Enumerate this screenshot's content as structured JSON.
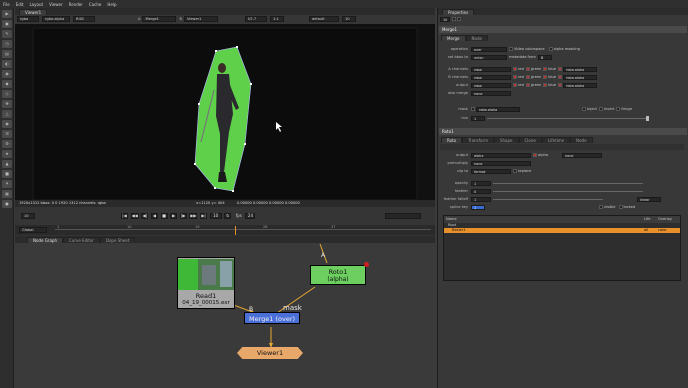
{
  "menu": [
    "File",
    "Edit",
    "Layout",
    "Viewer",
    "Render",
    "Cache",
    "Help"
  ],
  "toolbar_icons": [
    "pointer-icon",
    "image-icon",
    "draw-icon",
    "time-icon",
    "channel-icon",
    "color-icon",
    "filter-icon",
    "keyer-icon",
    "merge-icon",
    "transform-icon",
    "3d-icon",
    "views-icon",
    "metadata-icon",
    "toolsets-icon",
    "other-icon",
    "furnace-icon",
    "ofx-icon",
    "particles-icon",
    "deep-icon",
    "cara-icon"
  ],
  "viewer": {
    "tab_label": "Viewer1",
    "channels": "rgba",
    "channel_sub": "rgba.alpha",
    "channel_color": "RGB",
    "input_a": "Merge1",
    "input_b": "Viewer1",
    "zoom": "f/2.7",
    "frame": "10",
    "lut_default": "default",
    "lut_srgb": "sRGB",
    "proxy_label": "1:1",
    "lut_label": "gain",
    "status_text": "1920x1312 bbox: 0 0 1920 1312 channels: rgba",
    "status_coords": "x=1120 y= 404",
    "status_vals": "0.00000  0.00000  0.00000  0.00000",
    "frame_display": "10",
    "fps_label": "fps",
    "fps": "24",
    "range_mode": "Global",
    "ticks": [
      "1",
      "10",
      "19",
      "28",
      "37"
    ]
  },
  "nodegraph_tabs": [
    "Node Graph",
    "Curve Editor",
    "Dope Sheet"
  ],
  "nodes": {
    "read": {
      "label": "Read1",
      "sub": "04_19_00015.exr"
    },
    "roto": {
      "label": "Roto1",
      "sub": "(alpha)"
    },
    "merge": {
      "label": "Merge1 (over)"
    },
    "viewer": {
      "label": "Viewer1"
    },
    "mask_label": "mask",
    "a_label": "A",
    "b_label": "B"
  },
  "properties": {
    "panel_title": "Properties",
    "merge": {
      "title": "Merge1",
      "tabs": [
        "Merge",
        "Node"
      ],
      "operation_label": "operation",
      "operation": "over",
      "video_colorspace": "Video colorspace",
      "alpha_masking": "alpha masking",
      "set_bbox_label": "set bbox to",
      "set_bbox": "union",
      "metadata_from_label": "metadata from",
      "metadata_from": "B",
      "a_channels_label": "A channels",
      "a_channels": "rgba",
      "b_channels_label": "B channels",
      "b_channels": "rgba",
      "output_label": "output",
      "output": "rgba",
      "also_merge_label": "also merge",
      "also_merge": "none",
      "red": "red",
      "green": "green",
      "blue": "blue",
      "alpha": "rgba.alpha",
      "mask_label": "mask",
      "mask": "rgba.alpha",
      "inject": "inject",
      "invert": "invert",
      "fringe": "fringe",
      "mix_label": "mix",
      "mix": "1",
      "mix_ticks": [
        "0",
        "0.1",
        "0.2",
        "0.3",
        "0.4",
        "0.5",
        "0.6",
        "0.7",
        "0.8",
        "0.9",
        "1"
      ]
    },
    "roto": {
      "title": "Roto1",
      "tabs": [
        "Roto",
        "Transform",
        "Shape",
        "Clone",
        "Lifetime",
        "Node"
      ],
      "output_label": "output",
      "output": "alpha",
      "output_check": "alpha",
      "output_extra": "none",
      "premultiply_label": "premultiply",
      "premultiply": "none",
      "clip_to_label": "clip to",
      "clip_to": "format",
      "replace": "replace",
      "opacity_label": "opacity",
      "opacity": "1",
      "feather_label": "feather",
      "feather": "0",
      "feather_falloff_label": "feather falloff",
      "feather_falloff": "1",
      "falloff_type": "linear",
      "spline_key_label": "spline key",
      "spline_key": "1",
      "visible": "visible",
      "locked": "locked",
      "tree_header": [
        "Name",
        "",
        "",
        "",
        "Life",
        "Overlay"
      ],
      "tree_root": "Root",
      "tree_item": "Bezier1",
      "tree_item_life": "all",
      "tree_item_mode": "color"
    }
  },
  "accent_orange": "#e8902a",
  "roto_green": "#64d24e",
  "merge_blue": "#4a6fd8"
}
